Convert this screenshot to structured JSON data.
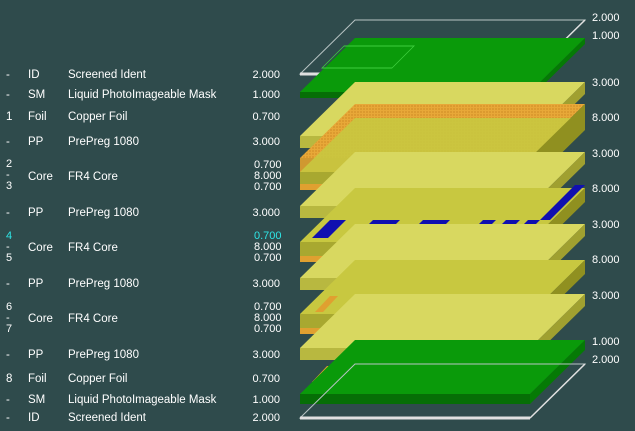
{
  "layers": [
    {
      "no": "-",
      "abbr": "ID",
      "material": "Screened Ident",
      "thickness": "2.000"
    },
    {
      "no": "-",
      "abbr": "SM",
      "material": "Liquid PhotoImageable Mask",
      "thickness": "1.000"
    },
    {
      "no": "1",
      "abbr": "Foil",
      "material": "Copper Foil",
      "thickness": "0.700"
    },
    {
      "no": "-",
      "abbr": "PP",
      "material": "PrePreg 1080",
      "thickness": "3.000"
    },
    {
      "no": "-",
      "abbr": "PP",
      "material": "PrePreg 1080",
      "thickness": "3.000"
    },
    {
      "no": "-",
      "abbr": "PP",
      "material": "PrePreg 1080",
      "thickness": "3.000"
    },
    {
      "no": "-",
      "abbr": "PP",
      "material": "PrePreg 1080",
      "thickness": "3.000"
    },
    {
      "no": "8",
      "abbr": "Foil",
      "material": "Copper Foil",
      "thickness": "0.700"
    },
    {
      "no": "-",
      "abbr": "SM",
      "material": "Liquid PhotoImageable Mask",
      "thickness": "1.000"
    },
    {
      "no": "-",
      "abbr": "ID",
      "material": "Screened Ident",
      "thickness": "2.000"
    }
  ],
  "cores": [
    {
      "nums": [
        "2",
        "-",
        "3"
      ],
      "abbr": "Core",
      "material": "FR4 Core",
      "thicknesses": [
        "0.700",
        "8.000",
        "0.700"
      ],
      "highlight": false
    },
    {
      "nums": [
        "4",
        "-",
        "5"
      ],
      "abbr": "Core",
      "material": "FR4 Core",
      "thicknesses": [
        "0.700",
        "8.000",
        "0.700"
      ],
      "highlight": true
    },
    {
      "nums": [
        "6",
        "-",
        "7"
      ],
      "abbr": "Core",
      "material": "FR4 Core",
      "thicknesses": [
        "0.700",
        "8.000",
        "0.700"
      ],
      "highlight": false
    }
  ],
  "right_labels": [
    "2.000",
    "1.000",
    "3.000",
    "8.000",
    "3.000",
    "8.000",
    "3.000",
    "8.000",
    "3.000",
    "1.000",
    "2.000"
  ],
  "colors": {
    "background": "#2f4b4c",
    "solder_mask": "#0a8c0a",
    "prepreg": "#d8d860",
    "core": "#b8b830",
    "copper": "#e0a030",
    "highlight_layer": "#1010b0",
    "highlight_text": "#2ee6e6"
  }
}
